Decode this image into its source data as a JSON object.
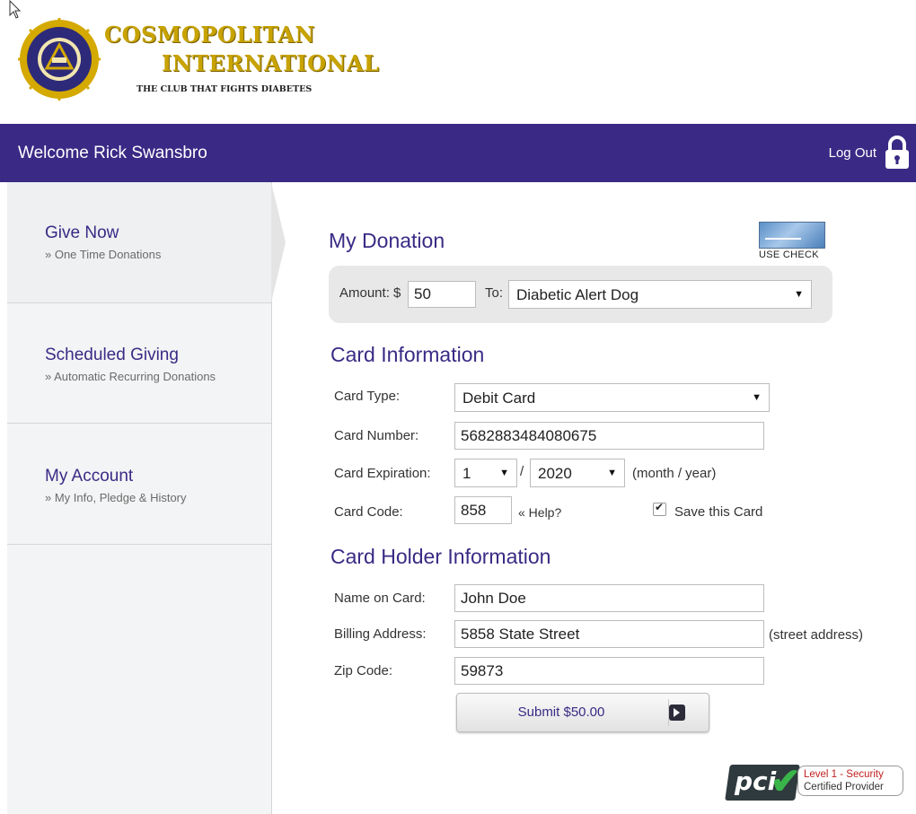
{
  "header": {
    "logo_line1": "COSMOPOLITAN",
    "logo_line2": "INTERNATIONAL",
    "logo_tagline": "THE CLUB THAT FIGHTS DIABETES",
    "welcome": "Welcome Rick Swansbro",
    "logout": "Log Out"
  },
  "sidebar": {
    "items": [
      {
        "title": "Give Now",
        "sub": "» One Time Donations"
      },
      {
        "title": "Scheduled Giving",
        "sub": "» Automatic Recurring Donations"
      },
      {
        "title": "My Account",
        "sub": "» My Info, Pledge & History"
      }
    ]
  },
  "donation": {
    "heading": "My Donation",
    "use_check": "USE CHECK",
    "amount_label": "Amount: $",
    "amount_value": "50",
    "to_label": "To:",
    "to_value": "Diabetic Alert Dog"
  },
  "card": {
    "heading": "Card Information",
    "type_label": "Card Type:",
    "type_value": "Debit Card",
    "number_label": "Card Number:",
    "number_value": "5682883484080675",
    "exp_label": "Card Expiration:",
    "exp_month": "1",
    "exp_sep": "/",
    "exp_year": "2020",
    "exp_hint": "(month / year)",
    "code_label": "Card Code:",
    "code_value": "858",
    "help": "« Help?",
    "save_label": "Save this Card",
    "save_checked": true
  },
  "holder": {
    "heading": "Card Holder Information",
    "name_label": "Name on Card:",
    "name_value": "John Doe",
    "address_label": "Billing Address:",
    "address_value": "5858 State Street",
    "address_hint": "(street address)",
    "zip_label": "Zip Code:",
    "zip_value": "59873"
  },
  "submit": {
    "label": "Submit $50.00"
  },
  "security": {
    "pci": "pci",
    "line1": "Level 1 - Security",
    "line2": "Certified Provider"
  },
  "colors": {
    "brand": "#3a2a85",
    "gold": "#c8a300",
    "pci_green": "#3ab54a",
    "pci_red": "#c02020"
  }
}
